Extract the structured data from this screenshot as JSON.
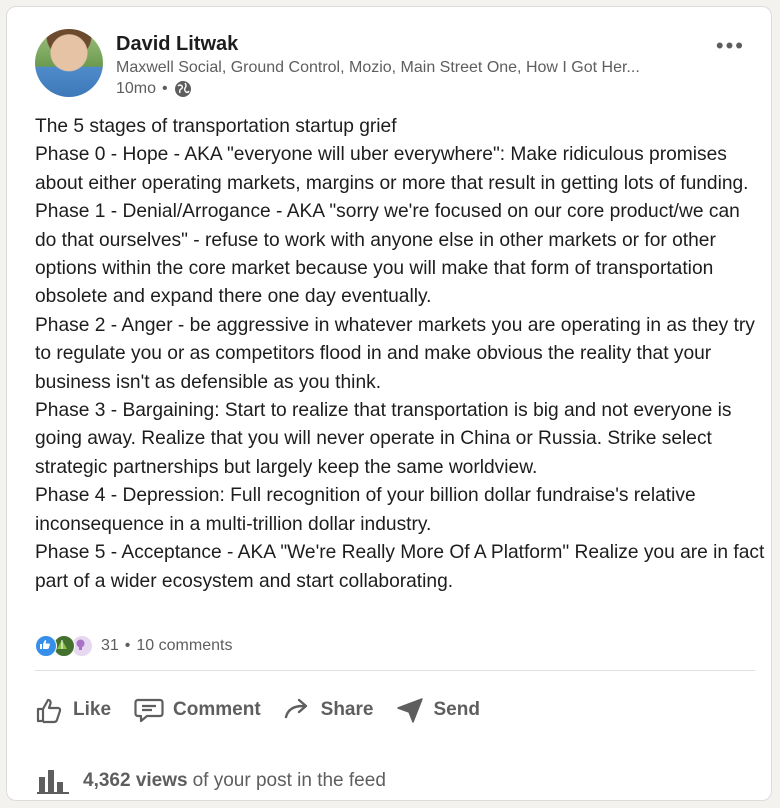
{
  "post": {
    "author": {
      "name": "David Litwak",
      "headline": "Maxwell Social, Ground Control, Mozio, Main Street One, How I Got Her...",
      "time": "10mo",
      "separator": "•",
      "visibility_icon": "globe-icon"
    },
    "more_label": "•••",
    "body_lines": [
      "The 5 stages of transportation startup grief",
      "Phase 0 - Hope - AKA \"everyone will uber everywhere\": Make ridiculous promises about either operating markets, margins or more that result in getting lots of funding.",
      "Phase 1 - Denial/Arrogance - AKA \"sorry we're focused on our core product/we can do that ourselves\" - refuse to work with anyone else in other markets or for other options within the core market because you will make that form of transportation obsolete and expand there one day eventually.",
      "Phase 2 - Anger - be aggressive in whatever markets you are operating in as they try to regulate you or as competitors flood in and make obvious the reality that your business isn't as defensible as you think.",
      "Phase 3 - Bargaining: Start to realize that transportation is big and not everyone is going away. Realize that you will never operate in China or Russia. Strike select strategic partnerships but largely keep the same worldview.",
      "Phase 4 - Depression: Full recognition of your billion dollar fundraise's relative inconsequence in a multi-trillion dollar industry.",
      "Phase 5 - Acceptance - AKA \"We're Really More Of A Platform\" Realize you are in fact part of a wider ecosystem and start collaborating."
    ],
    "reactions": {
      "icons": [
        "like-icon",
        "celebrate-icon",
        "insightful-icon"
      ],
      "count": "31",
      "separator": "•",
      "comments": "10 comments"
    },
    "actions": {
      "like": "Like",
      "comment": "Comment",
      "share": "Share",
      "send": "Send"
    },
    "views": {
      "count": "4,362 views",
      "suffix": "of your post in the feed"
    }
  },
  "colors": {
    "page_bg": "#f3f2ef",
    "card_bg": "#ffffff",
    "text": "#1d1d1d",
    "muted": "#5e5e5e",
    "like_blue": "#378fe9"
  }
}
